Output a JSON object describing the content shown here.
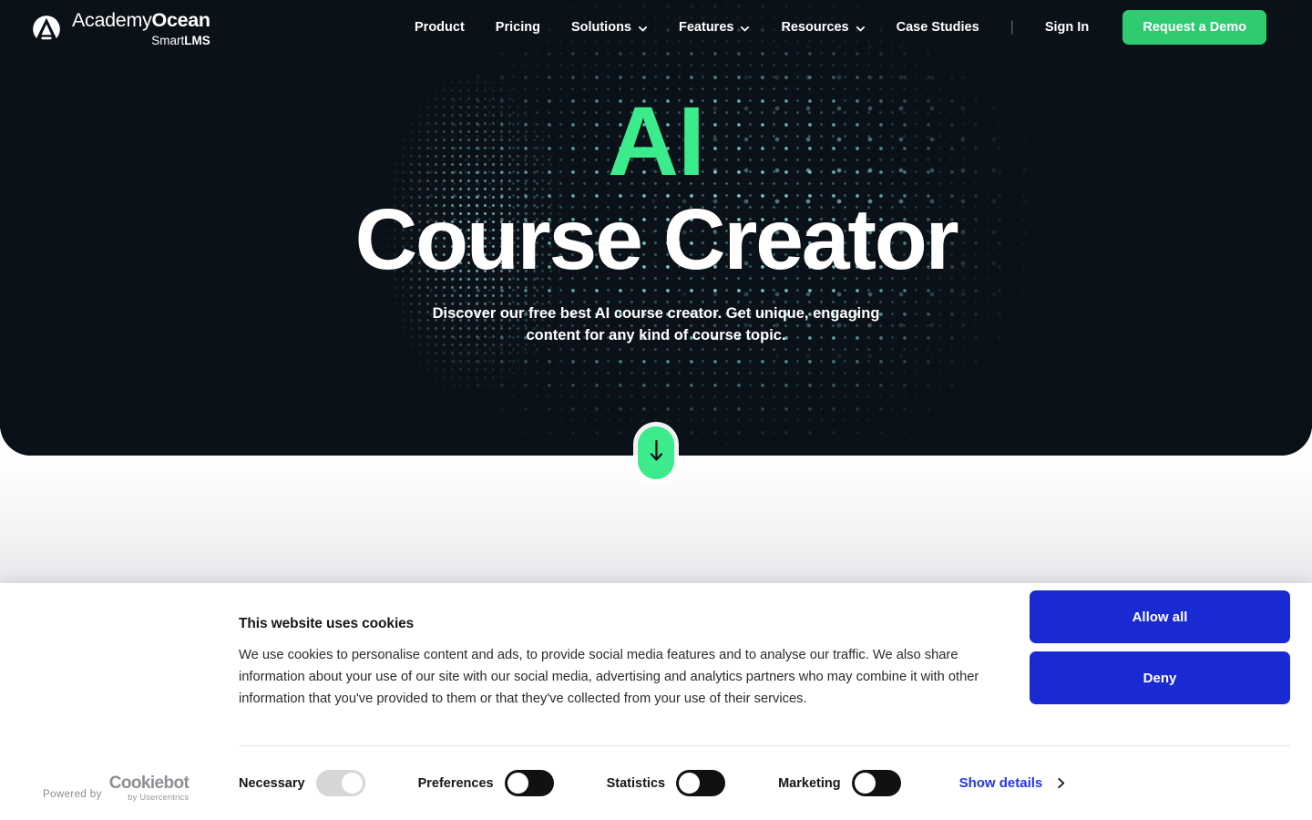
{
  "brand": {
    "logo_icon": "academyocean-a-mark-icon",
    "name_light": "Academy",
    "name_bold": "Ocean",
    "tagline_light": "Smart",
    "tagline_bold": "LMS"
  },
  "nav": {
    "items": [
      {
        "label": "Product",
        "has_dropdown": false,
        "icon": ""
      },
      {
        "label": "Pricing",
        "has_dropdown": false,
        "icon": ""
      },
      {
        "label": "Solutions",
        "has_dropdown": true,
        "icon": "chevron-down-icon"
      },
      {
        "label": "Features",
        "has_dropdown": true,
        "icon": "chevron-down-icon"
      },
      {
        "label": "Resources",
        "has_dropdown": true,
        "icon": "chevron-down-icon"
      },
      {
        "label": "Case Studies",
        "has_dropdown": false,
        "icon": ""
      }
    ],
    "separator": "|",
    "sign_in": "Sign In",
    "cta": "Request a Demo",
    "cta_color": "#2ecb71"
  },
  "hero": {
    "heading_accent": "AI",
    "heading_accent_color": "#3ceb8b",
    "heading_main": "Course Creator",
    "subtitle": "Discover our free best AI course creator. Get unique, engaging content for any kind of course topic.",
    "background_color": "#0a1119",
    "scroll_icon": "arrow-down-icon",
    "scroll_button_color": "#3ceb8b"
  },
  "cookie_banner": {
    "title": "This website uses cookies",
    "body": "We use cookies to personalise content and ads, to provide social media features and to analyse our traffic. We also share information about your use of our site with our social media, advertising and analytics partners who may combine it with other information that you've provided to them or that they've collected from your use of their services.",
    "allow_all": "Allow all",
    "deny": "Deny",
    "button_color": "#1a2ad2",
    "powered_by_label": "Powered by",
    "powered_by_brand": "Cookiebot",
    "powered_by_sub": "by Usercentrics",
    "categories": [
      {
        "label": "Necessary",
        "state": "on",
        "locked": true
      },
      {
        "label": "Preferences",
        "state": "off",
        "locked": false
      },
      {
        "label": "Statistics",
        "state": "off",
        "locked": false
      },
      {
        "label": "Marketing",
        "state": "off",
        "locked": false
      }
    ],
    "show_details": "Show details",
    "show_details_icon": "chevron-right-icon",
    "show_details_color": "#2236e8"
  }
}
